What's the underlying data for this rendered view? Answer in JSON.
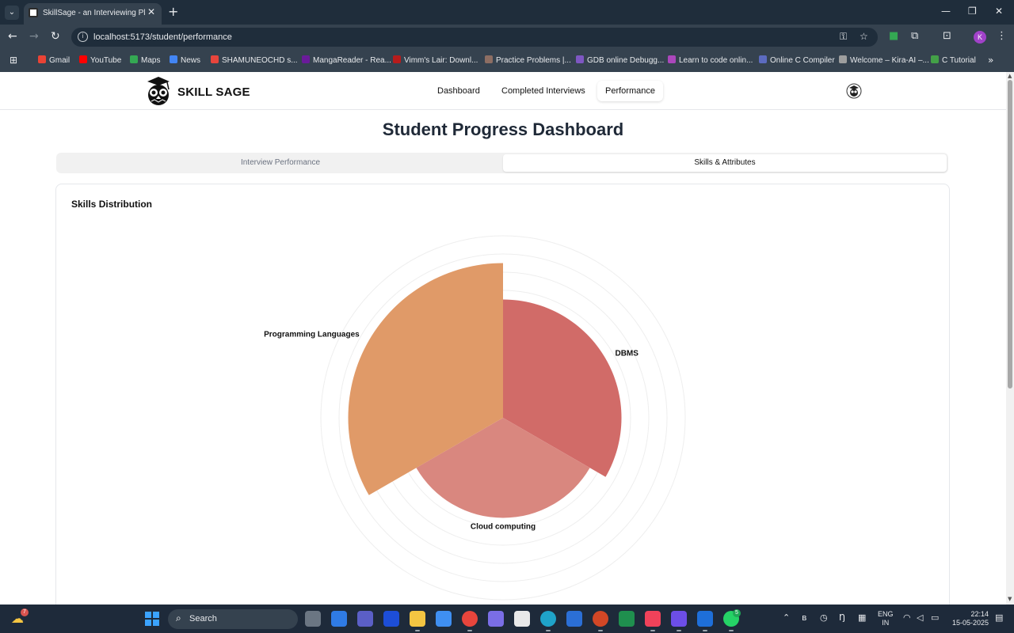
{
  "browser": {
    "tab_title": "SkillSage - an Interviewing Platf",
    "url": "localhost:5173/student/performance",
    "bookmarks": [
      {
        "label": "Gmail",
        "color": "#ea4335"
      },
      {
        "label": "YouTube",
        "color": "#ff0000"
      },
      {
        "label": "Maps",
        "color": "#34a853"
      },
      {
        "label": "News",
        "color": "#4285f4"
      },
      {
        "label": "SHAMUNEOCHD s...",
        "color": "#e8453c"
      },
      {
        "label": "MangaReader - Rea...",
        "color": "#6a1b9a"
      },
      {
        "label": "Vimm's Lair: Downl...",
        "color": "#b71c1c"
      },
      {
        "label": "Practice Problems |...",
        "color": "#8d6e63"
      },
      {
        "label": "GDB online Debugg...",
        "color": "#7e57c2"
      },
      {
        "label": "Learn to code onlin...",
        "color": "#ab47bc"
      },
      {
        "label": "Online C Compiler",
        "color": "#5c6bc0"
      },
      {
        "label": "Welcome – Kira-AI –...",
        "color": "#9e9e9e"
      },
      {
        "label": "C Tutorial",
        "color": "#43a047"
      }
    ],
    "profile_initial": "K"
  },
  "app": {
    "brand": "SKILL SAGE",
    "nav": [
      "Dashboard",
      "Completed Interviews",
      "Performance"
    ],
    "active_nav": "Performance"
  },
  "page": {
    "title": "Student Progress Dashboard",
    "tabs": [
      "Interview Performance",
      "Skills & Attributes"
    ],
    "active_tab": "Skills & Attributes"
  },
  "card": {
    "title": "Skills Distribution"
  },
  "chart_data": {
    "type": "polar_area",
    "categories": [
      "DBMS",
      "Cloud computing",
      "Programming Languages"
    ],
    "values": [
      6.5,
      5.5,
      8.5
    ],
    "colors": [
      "#d16b68",
      "#d9877f",
      "#e09a68"
    ],
    "rlim": [
      0,
      10
    ],
    "grid": true,
    "legend": "none"
  },
  "taskbar": {
    "weather_badge": "7",
    "search_label": "Search",
    "whatsapp_badge": "5",
    "lang_line1": "ENG",
    "lang_line2": "IN",
    "time": "22:14",
    "date": "15-05-2025"
  }
}
